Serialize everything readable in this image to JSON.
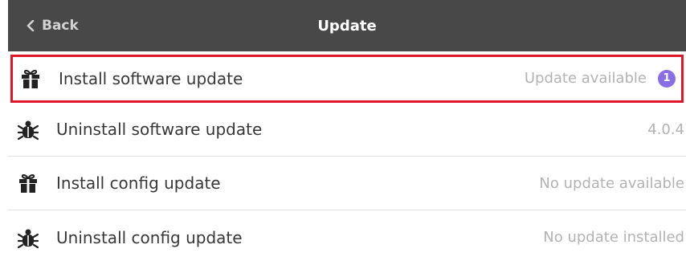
{
  "header": {
    "back_label": "Back",
    "title": "Update",
    "background": "#484848"
  },
  "rows": [
    {
      "label": "Install software update",
      "value": "Update available",
      "badge": "1",
      "icon": "gift-icon",
      "selected": true
    },
    {
      "label": "Uninstall software update",
      "value": "4.0.4",
      "icon": "bug-icon"
    },
    {
      "label": "Install config update",
      "value": "No update available",
      "icon": "gift-icon"
    },
    {
      "label": "Uninstall config update",
      "value": "No update installed",
      "icon": "bug-icon"
    }
  ],
  "colors": {
    "selection_border": "#e0142a",
    "badge": "#8a6ee8",
    "value_text": "#b3b3b3"
  }
}
